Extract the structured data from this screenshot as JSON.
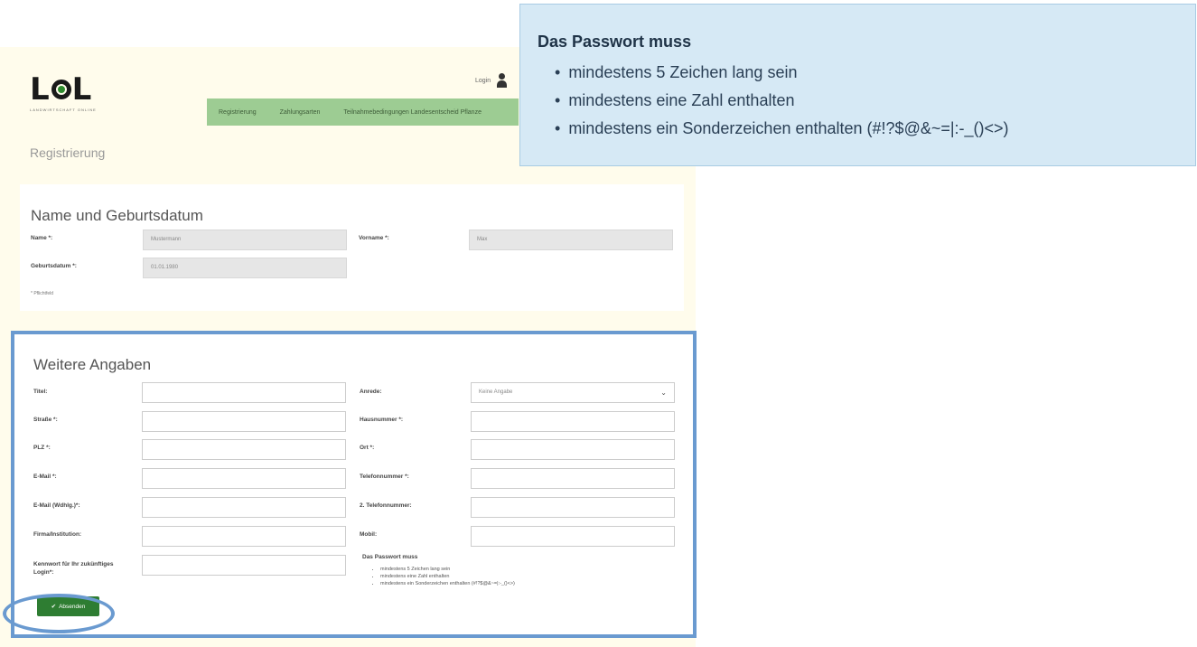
{
  "app": {
    "logo_text": "LOL",
    "logo_subtitle": "LANDWIRTSCHAFT ONLINE",
    "login_label": "Login"
  },
  "nav": {
    "items": [
      "Registrierung",
      "Zahlungsarten",
      "Teilnahmebedingungen Landesentscheid Pflanze"
    ]
  },
  "page_title": "Registrierung",
  "section_name": {
    "title": "Name und Geburtsdatum",
    "name_label": "Name *:",
    "name_value": "Mustermann",
    "vorname_label": "Vorname *:",
    "vorname_value": "Max",
    "birth_label": "Geburtsdatum *:",
    "birth_value": "01.01.1980",
    "required_note": "* Pflichtfeld"
  },
  "section_more": {
    "title": "Weitere Angaben",
    "fields_left": [
      {
        "label": "Titel:",
        "value": ""
      },
      {
        "label": "Straße *:",
        "value": ""
      },
      {
        "label": "PLZ *:",
        "value": ""
      },
      {
        "label": "E-Mail *:",
        "value": ""
      },
      {
        "label": "E-Mail (Wdhlg.)*:",
        "value": ""
      },
      {
        "label": "Firma/Institution:",
        "value": ""
      },
      {
        "label": "Kennwort für Ihr zukünftiges Login*:",
        "value": ""
      }
    ],
    "fields_right": [
      {
        "label": "Anrede:",
        "value": "Keine Angabe"
      },
      {
        "label": "Hausnummer *:",
        "value": ""
      },
      {
        "label": "Ort *:",
        "value": ""
      },
      {
        "label": "Telefonnummer *:",
        "value": ""
      },
      {
        "label": "2. Telefonnummer:",
        "value": ""
      },
      {
        "label": "Mobil:",
        "value": ""
      }
    ],
    "password_hint_title": "Das Passwort muss",
    "password_hints": [
      "mindestens 5 Zeichen lang sein",
      "mindestens eine Zahl enthalten",
      "mindestens ein Sonderzeichen enthalten (#!?$@&~=|:-_()<>)"
    ],
    "submit_label": "Absenden",
    "submit_icon": "check-icon"
  },
  "callout": {
    "title": "Das Passwort muss",
    "items": [
      "mindestens 5 Zeichen lang sein",
      "mindestens eine Zahl enthalten",
      "mindestens ein Sonderzeichen enthalten (#!?$@&~=|:-_()<>)"
    ]
  },
  "colors": {
    "highlight_border": "#6a9ad0",
    "nav_green": "#9dcc93",
    "submit_green": "#2e7d32",
    "callout_bg": "#d6e9f5"
  }
}
